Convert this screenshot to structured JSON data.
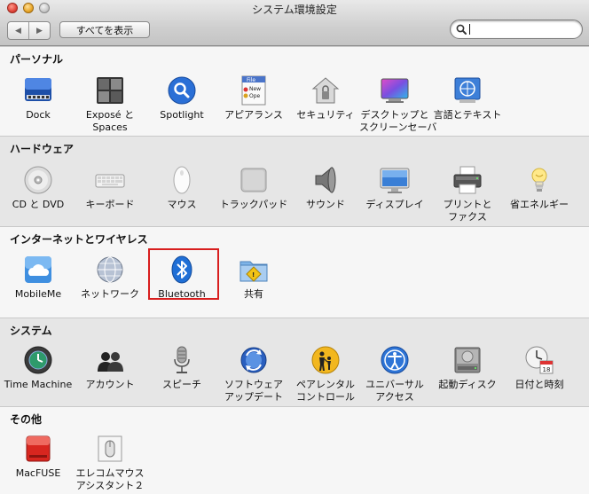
{
  "window": {
    "title": "システム環境設定"
  },
  "toolbar": {
    "back_label": "◀",
    "forward_label": "▶",
    "show_all_label": "すべてを表示",
    "search_value": "",
    "search_placeholder": ""
  },
  "sections": {
    "personal": {
      "title": "パーソナル",
      "items": [
        {
          "label": "Dock",
          "label2": "",
          "icon": "dock-icon"
        },
        {
          "label": "Exposé と",
          "label2": "Spaces",
          "icon": "expose-spaces-icon"
        },
        {
          "label": "Spotlight",
          "label2": "",
          "icon": "spotlight-icon"
        },
        {
          "label": "アピアランス",
          "label2": "",
          "icon": "appearance-icon"
        },
        {
          "label": "セキュリティ",
          "label2": "",
          "icon": "security-icon"
        },
        {
          "label": "デスクトップと",
          "label2": "スクリーンセーバ",
          "icon": "desktop-screensaver-icon"
        },
        {
          "label": "言語とテキスト",
          "label2": "",
          "icon": "language-text-icon"
        }
      ]
    },
    "hardware": {
      "title": "ハードウェア",
      "items": [
        {
          "label": "CD と DVD",
          "label2": "",
          "icon": "cd-dvd-icon"
        },
        {
          "label": "キーボード",
          "label2": "",
          "icon": "keyboard-icon"
        },
        {
          "label": "マウス",
          "label2": "",
          "icon": "mouse-icon"
        },
        {
          "label": "トラックパッド",
          "label2": "",
          "icon": "trackpad-icon"
        },
        {
          "label": "サウンド",
          "label2": "",
          "icon": "sound-icon"
        },
        {
          "label": "ディスプレイ",
          "label2": "",
          "icon": "display-icon"
        },
        {
          "label": "プリントと",
          "label2": "ファクス",
          "icon": "print-fax-icon"
        },
        {
          "label": "省エネルギー",
          "label2": "",
          "icon": "energy-saver-icon"
        }
      ]
    },
    "internet": {
      "title": "インターネットとワイヤレス",
      "items": [
        {
          "label": "MobileMe",
          "label2": "",
          "icon": "mobileme-icon"
        },
        {
          "label": "ネットワーク",
          "label2": "",
          "icon": "network-icon"
        },
        {
          "label": "Bluetooth",
          "label2": "",
          "icon": "bluetooth-icon"
        },
        {
          "label": "共有",
          "label2": "",
          "icon": "sharing-icon"
        }
      ]
    },
    "system": {
      "title": "システム",
      "items": [
        {
          "label": "Time Machine",
          "label2": "",
          "icon": "time-machine-icon"
        },
        {
          "label": "アカウント",
          "label2": "",
          "icon": "accounts-icon"
        },
        {
          "label": "スピーチ",
          "label2": "",
          "icon": "speech-icon"
        },
        {
          "label": "ソフトウェア",
          "label2": "アップデート",
          "icon": "software-update-icon"
        },
        {
          "label": "ペアレンタル",
          "label2": "コントロール",
          "icon": "parental-controls-icon"
        },
        {
          "label": "ユニバーサル",
          "label2": "アクセス",
          "icon": "universal-access-icon"
        },
        {
          "label": "起動ディスク",
          "label2": "",
          "icon": "startup-disk-icon"
        },
        {
          "label": "日付と時刻",
          "label2": "",
          "icon": "date-time-icon"
        }
      ]
    },
    "other": {
      "title": "その他",
      "items": [
        {
          "label": "MacFUSE",
          "label2": "",
          "icon": "macfuse-icon"
        },
        {
          "label": "エレコムマウス",
          "label2": "アシスタント２",
          "icon": "elecom-mouse-assistant-icon"
        }
      ],
      "calendar_day": "18"
    }
  },
  "colors": {
    "highlight": "#d81e1e",
    "accent_blue": "#1f6fd6"
  }
}
